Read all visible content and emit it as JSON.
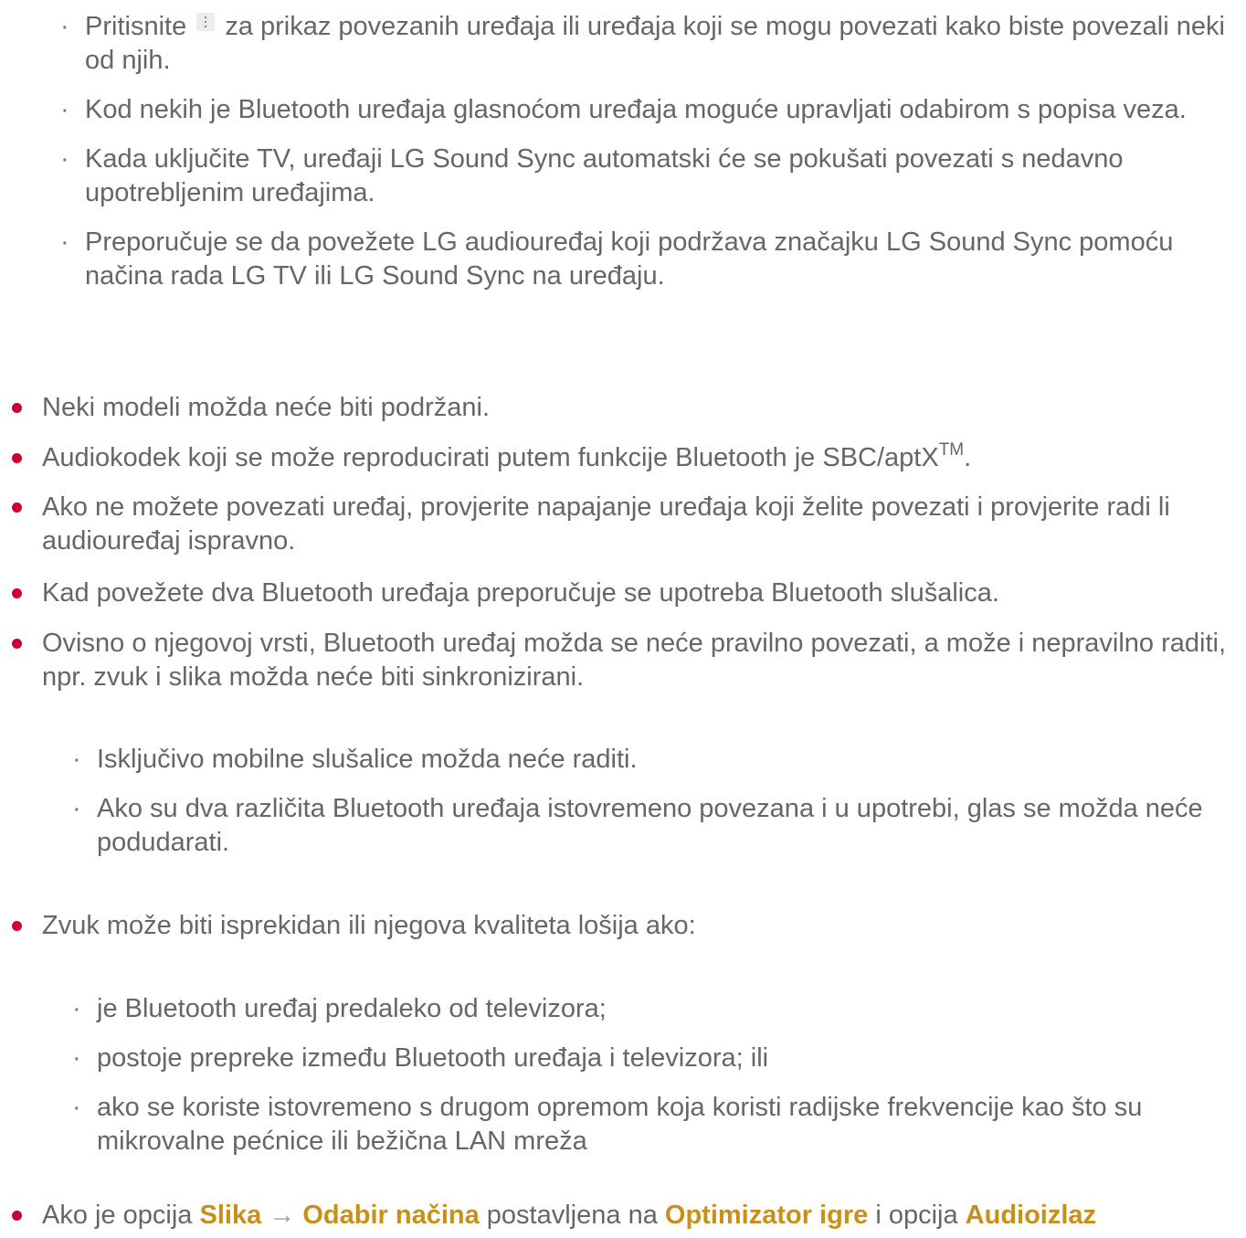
{
  "sub1": {
    "i1_before": "Pritisnite",
    "i1_after": "za prikaz povezanih uređaja ili uređaja koji se mogu povezati kako biste povezali neki od njih.",
    "i2": "Kod nekih je Bluetooth uređaja glasnoćom uređaja moguće upravljati odabirom s popisa veza.",
    "i3": "Kada uključite TV, uređaji LG Sound Sync automatski će se pokušati povezati s nedavno upotrebljenim uređajima.",
    "i4": "Preporučuje se da povežete LG audiouređaj koji podržava značajku LG Sound Sync pomoću načina rada LG TV ili LG Sound Sync na uređaju."
  },
  "icons": {
    "more": "more-options-icon"
  },
  "colors": {
    "bullet": "#cc0033",
    "highlight": "#c8901a",
    "text": "#666666"
  },
  "b1": "Neki modeli možda neće biti podržani.",
  "b2": {
    "text": "Audiokodek koji se može reproducirati putem funkcije Bluetooth je SBC/aptX",
    "sup": "TM",
    "end": "."
  },
  "b3": "Ako ne možete povezati uređaj, provjerite napajanje uređaja koji želite povezati i provjerite radi li audiouređaj ispravno.",
  "b4": "Kad povežete dva Bluetooth uređaja preporučuje se upotreba Bluetooth slušalica.",
  "b5": "Ovisno o njegovoj vrsti, Bluetooth uređaj možda se neće pravilno povezati, a može i nepravilno raditi, npr. zvuk i slika možda neće biti sinkronizirani.",
  "sub2": {
    "i1": "Isključivo mobilne slušalice možda neće raditi.",
    "i2": "Ako su dva različita Bluetooth uređaja istovremeno povezana i u upotrebi, glas se možda neće podudarati."
  },
  "b6": "Zvuk može biti isprekidan ili njegova kvaliteta lošija ako:",
  "sub3": {
    "i1": "je Bluetooth uređaj predaleko od televizora;",
    "i2": "postoje prepreke između Bluetooth uređaja i televizora; ili",
    "i3": "ako se koriste istovremeno s drugom opremom koja koristi radijske frekvencije kao što su mikrovalne pećnice ili bežična LAN mreža"
  },
  "b7": {
    "t1": "Ako je opcija",
    "h1": "Slika",
    "arrow": "→",
    "h2": "Odabir načina",
    "t2": "postavljena na",
    "h3": "Optimizator igre",
    "t3": "i opcija",
    "h4": "Audioizlaz"
  }
}
